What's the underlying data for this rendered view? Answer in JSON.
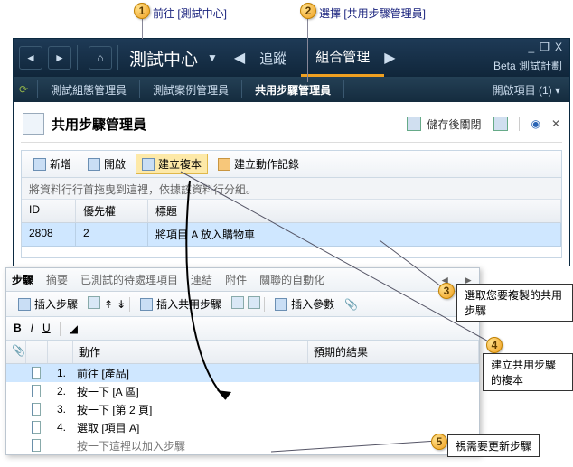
{
  "callouts": {
    "c1": {
      "num": "1",
      "label": "前往 [測試中心]"
    },
    "c2": {
      "num": "2",
      "label": "選擇 [共用步驟管理員]"
    },
    "c3": {
      "num": "3",
      "label": "選取您要複製的共用步驟"
    },
    "c4": {
      "num": "4",
      "label": "建立共用步驟的複本"
    },
    "c5": {
      "num": "5",
      "label": "視需要更新步驟"
    }
  },
  "titlebar": {
    "title": "測試中心",
    "nav_track": "追蹤",
    "nav_org": "組合管理",
    "plan_label": "Beta 測試計劃",
    "win_min": "_",
    "win_rest": "❐",
    "win_close": "X"
  },
  "subtabs": {
    "t1": "測試組態管理員",
    "t2": "測試案例管理員",
    "t3": "共用步驟管理員",
    "right": "開啟項目 (1) ▾"
  },
  "workhead": {
    "title": "共用步驟管理員",
    "save": "儲存後關閉"
  },
  "toolbar": {
    "new": "新增",
    "open": "開啟",
    "dup": "建立複本",
    "actlog": "建立動作記錄"
  },
  "group_hint": "將資料行行首拖曳到這裡，依據該資料行分組。",
  "grid": {
    "h_id": "ID",
    "h_pri": "優先權",
    "h_title": "標題",
    "r_id": "2808",
    "r_pri": "2",
    "r_title": "將項目 A 放入購物車"
  },
  "steps_tabs": {
    "t1": "步驟",
    "t2": "摘要",
    "t3": "已測試的待處理項目",
    "t4": "連結",
    "t5": "附件",
    "t6": "關聯的自動化"
  },
  "steps_tb": {
    "insert": "插入步驟",
    "insert_shared": "插入共用步驟",
    "insert_param": "插入參數"
  },
  "steps_head": {
    "action": "動作",
    "expect": "預期的結果"
  },
  "steps": {
    "s1_n": "1.",
    "s1": "前往 [產品]",
    "s2_n": "2.",
    "s2": "按一下 [A 區]",
    "s3_n": "3.",
    "s3": "按一下 [第 2 頁]",
    "s4_n": "4.",
    "s4": "選取 [項目 A]",
    "s5_n": "",
    "s5": "按一下這裡以加入步驟"
  }
}
